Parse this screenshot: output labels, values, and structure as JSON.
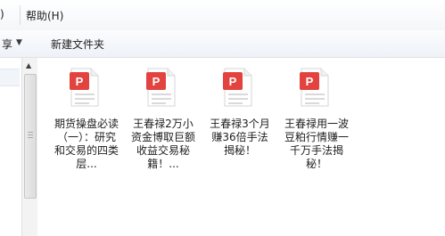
{
  "menu": {
    "partial_label": ")",
    "help_label": "帮助(H)"
  },
  "toolbar": {
    "partial_label": "享",
    "dropdown_icon": "triangle-down-icon",
    "new_folder_label": "新建文件夹"
  },
  "files": [
    {
      "icon": "pdf-file-icon",
      "name": "期货操盘必读（一）：研究和交易的四类层..."
    },
    {
      "icon": "pdf-file-icon",
      "name": "王春禄2万小资金博取巨额收益交易秘籍！..."
    },
    {
      "icon": "pdf-file-icon",
      "name": "王春禄3个月赚36倍手法揭秘！"
    },
    {
      "icon": "pdf-file-icon",
      "name": "王春禄用一波豆粕行情赚一千万手法揭秘！"
    }
  ],
  "colors": {
    "pdf_red": "#e2433f",
    "pdf_page": "#ffffff",
    "pdf_lines": "#d9d9d9"
  }
}
